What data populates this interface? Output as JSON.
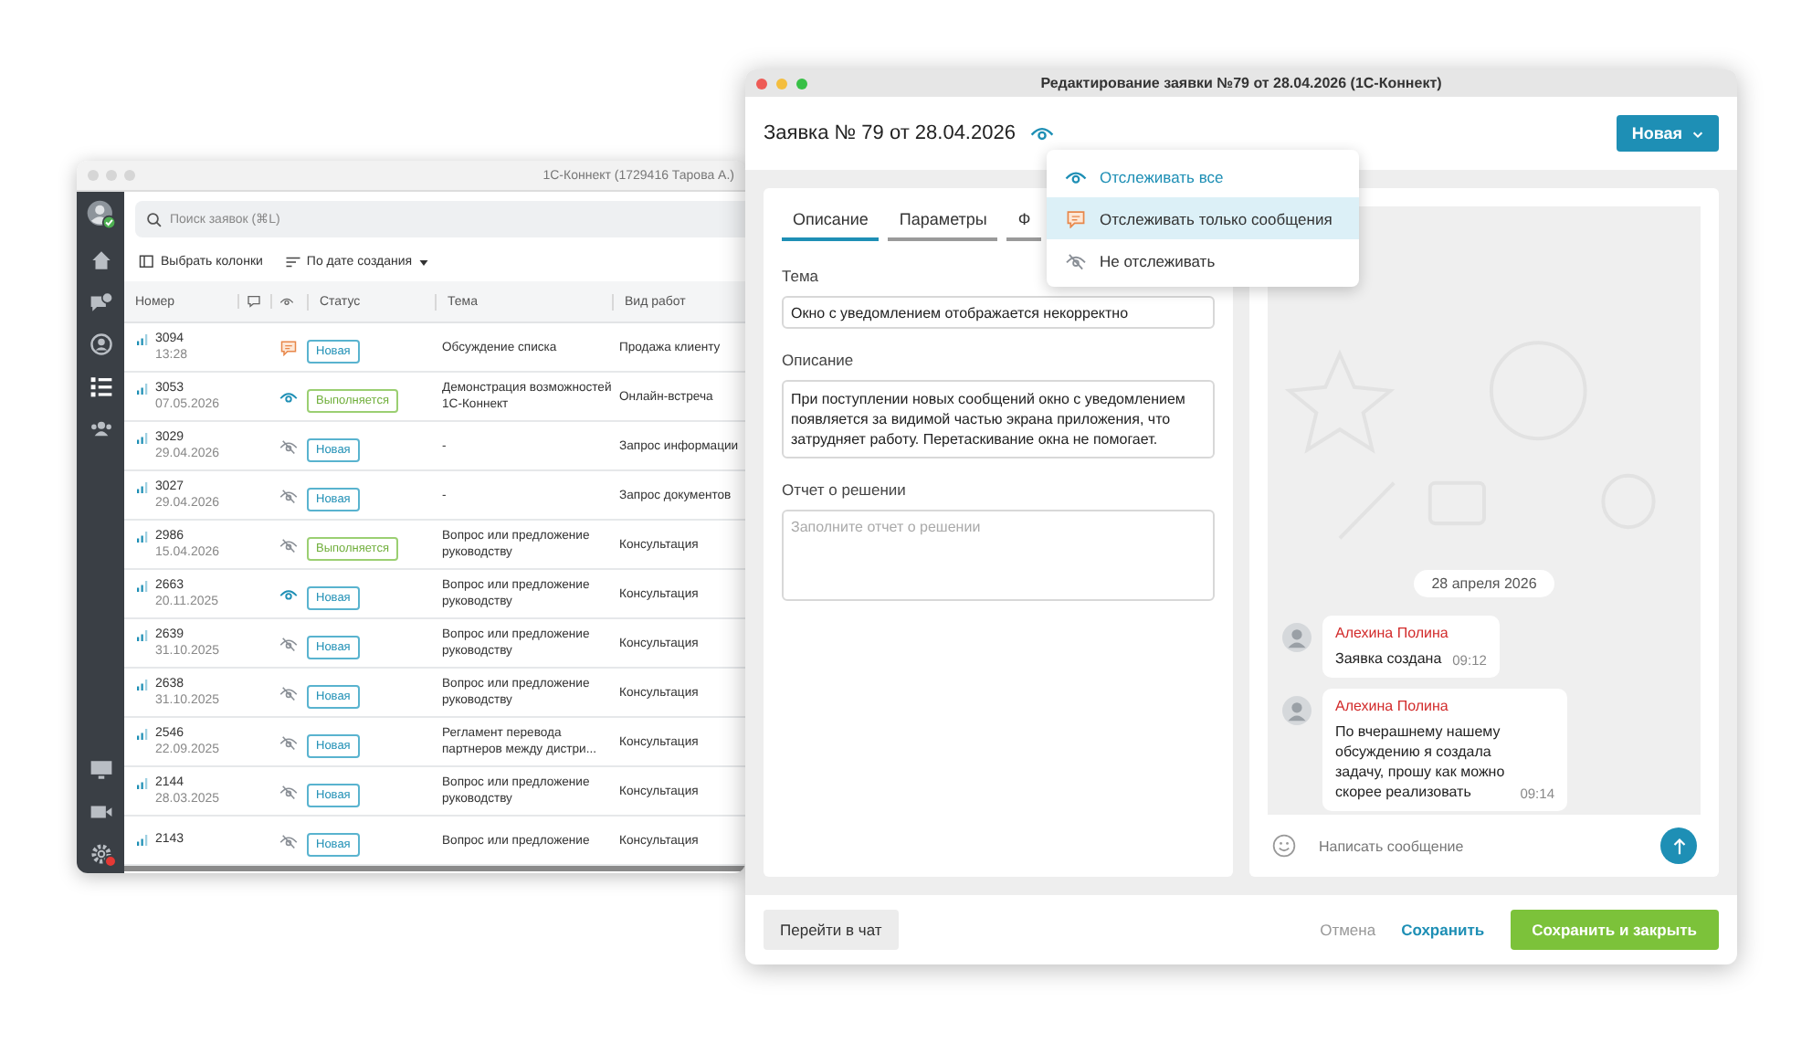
{
  "list_window": {
    "title": "1С-Коннект (1729416 Тарова А.)",
    "sidebar": {
      "top": [
        {
          "kind": "home",
          "selected": false
        },
        {
          "kind": "chat",
          "selected": false
        },
        {
          "kind": "profile",
          "selected": false
        },
        {
          "kind": "list",
          "selected": true
        },
        {
          "kind": "team",
          "selected": false
        }
      ],
      "bottom": [
        {
          "kind": "screen",
          "badge": false
        },
        {
          "kind": "video",
          "badge": false
        },
        {
          "kind": "settings",
          "badge": true
        }
      ]
    },
    "search": {
      "placeholder": "Поиск заявок (⌘L)"
    },
    "toolbar": {
      "columns_button": "Выбрать колонки",
      "sort_button": "По дате создания"
    },
    "table": {
      "columns": {
        "number": "Номер",
        "status": "Статус",
        "topic": "Тема",
        "work_type": "Вид работ"
      },
      "rows": [
        {
          "number": "3094",
          "date": "13:28",
          "watch": {
            "kind": "messages"
          },
          "status": {
            "label": "Новая",
            "kind": "new"
          },
          "topic": "Обсуждение списка",
          "work_type": "Продажа клиенту"
        },
        {
          "number": "3053",
          "date": "07.05.2026",
          "watch": {
            "kind": "all"
          },
          "status": {
            "label": "Выполняется",
            "kind": "progress"
          },
          "topic": "Демонстрация возможностей 1С-Коннект",
          "work_type": "Онлайн-встреча"
        },
        {
          "number": "3029",
          "date": "29.04.2026",
          "watch": {
            "kind": "none"
          },
          "status": {
            "label": "Новая",
            "kind": "new"
          },
          "topic": "-",
          "work_type": "Запрос информации"
        },
        {
          "number": "3027",
          "date": "29.04.2026",
          "watch": {
            "kind": "none"
          },
          "status": {
            "label": "Новая",
            "kind": "new"
          },
          "topic": "-",
          "work_type": "Запрос документов"
        },
        {
          "number": "2986",
          "date": "15.04.2026",
          "watch": {
            "kind": "none"
          },
          "status": {
            "label": "Выполняется",
            "kind": "progress"
          },
          "topic": "Вопрос или предложение руководству",
          "work_type": "Консультация"
        },
        {
          "number": "2663",
          "date": "20.11.2025",
          "watch": {
            "kind": "all"
          },
          "status": {
            "label": "Новая",
            "kind": "new"
          },
          "topic": "Вопрос или предложение руководству",
          "work_type": "Консультация"
        },
        {
          "number": "2639",
          "date": "31.10.2025",
          "watch": {
            "kind": "none"
          },
          "status": {
            "label": "Новая",
            "kind": "new"
          },
          "topic": "Вопрос или предложение руководству",
          "work_type": "Консультация"
        },
        {
          "number": "2638",
          "date": "31.10.2025",
          "watch": {
            "kind": "none"
          },
          "status": {
            "label": "Новая",
            "kind": "new"
          },
          "topic": "Вопрос или предложение руководству",
          "work_type": "Консультация"
        },
        {
          "number": "2546",
          "date": "22.09.2025",
          "watch": {
            "kind": "none"
          },
          "status": {
            "label": "Новая",
            "kind": "new"
          },
          "topic": "Регламент перевода партнеров между дистри...",
          "work_type": "Консультация"
        },
        {
          "number": "2144",
          "date": "28.03.2025",
          "watch": {
            "kind": "none"
          },
          "status": {
            "label": "Новая",
            "kind": "new"
          },
          "topic": "Вопрос или предложение руководству",
          "work_type": "Консультация"
        },
        {
          "number": "2143",
          "watch": {
            "kind": "none"
          },
          "status": {
            "label": "Новая",
            "kind": "new"
          },
          "topic": "Вопрос или предложение",
          "work_type": "Консультация"
        }
      ]
    }
  },
  "edit_window": {
    "title": "Редактирование заявки №79 от 28.04.2026 (1С-Коннект)",
    "heading": "Заявка № 79 от 28.04.2026",
    "status_button": "Новая",
    "watch_menu": {
      "items": [
        {
          "kind": "all",
          "label": "Отслеживать все",
          "selected": false
        },
        {
          "kind": "messages",
          "label": "Отслеживать только сообщения",
          "selected": true
        },
        {
          "kind": "none",
          "label": "Не отслеживать",
          "selected": false
        }
      ]
    },
    "tabs": [
      {
        "label": "Описание",
        "selected": true
      },
      {
        "label": "Параметры",
        "selected": false
      },
      {
        "label": "Ф",
        "selected": false
      }
    ],
    "topic": {
      "label": "Тема",
      "value": "Окно с уведомлением отображается некорректно"
    },
    "description": {
      "label": "Описание",
      "value": "При поступлении новых сообщений окно с уведомлением появляется за видимой частью экрана приложения, что затрудняет работу. Перетаскивание окна не помогает."
    },
    "report": {
      "label": "Отчет о решении",
      "placeholder": "Заполните отчет о решении"
    },
    "chat": {
      "date": "28 апреля 2026",
      "messages": [
        {
          "author": "Алехина Полина",
          "text": "Заявка создана",
          "time": "09:12"
        },
        {
          "author": "Алехина Полина",
          "text": "По вчерашнему нашему обсуждению я создала задачу, прошу как можно скорее реализовать",
          "time": "09:14"
        }
      ],
      "input": {
        "placeholder": "Написать сообщение"
      }
    },
    "footer": {
      "chat_button": "Перейти в чат",
      "cancel": "Отмена",
      "save": "Сохранить",
      "save_close": "Сохранить и закрыть"
    }
  }
}
